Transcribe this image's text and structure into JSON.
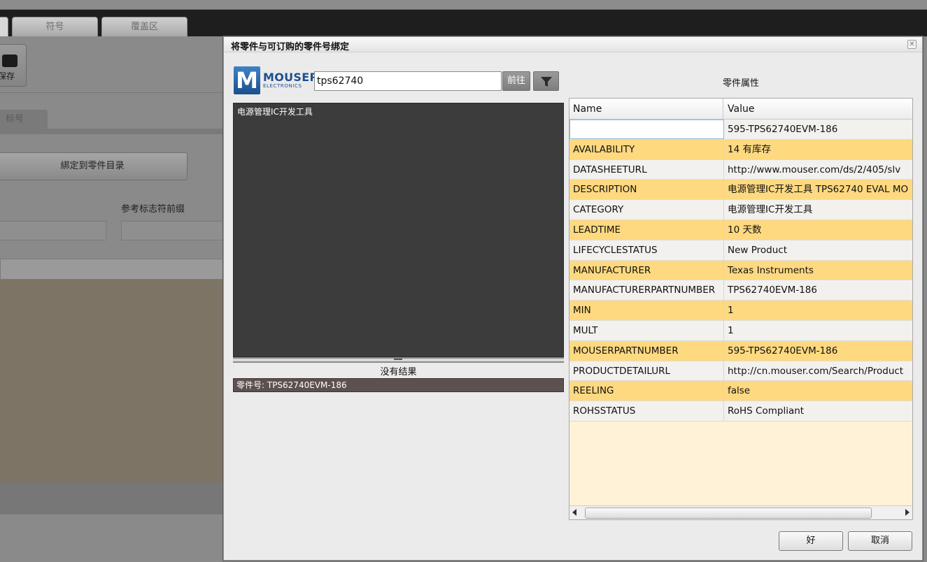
{
  "app": {
    "tabs": [
      {
        "label": ""
      },
      {
        "label": "符号"
      },
      {
        "label": "覆盖区"
      }
    ],
    "toolbar": {
      "save_label": "保存"
    },
    "sub_tab": "标号",
    "bind_catalog_button": "綁定到零件目录",
    "prefix_label": "参考标志符前缀"
  },
  "dialog": {
    "title": "将零件与可订购的零件号绑定",
    "close_icon": "close-icon",
    "logo": {
      "word": "MOUSER",
      "sub": "ELECTRONICS"
    },
    "search": {
      "value": "tps62740",
      "go_label": "前往",
      "filter_icon": "filter-icon"
    },
    "category_tree": {
      "items": [
        "电源管理IC开发工具"
      ]
    },
    "no_results": "没有结果",
    "part_result": "零件号: TPS62740EVM-186",
    "properties": {
      "title": "零件属性",
      "columns": {
        "name": "Name",
        "value": "Value"
      },
      "rows": [
        {
          "name": "",
          "value": "595-TPS62740EVM-186"
        },
        {
          "name": "AVAILABILITY",
          "value": "14 有库存"
        },
        {
          "name": "DATASHEETURL",
          "value": "http://www.mouser.com/ds/2/405/slv"
        },
        {
          "name": "DESCRIPTION",
          "value": "电源管理IC开发工具 TPS62740 EVAL MO"
        },
        {
          "name": "CATEGORY",
          "value": "电源管理IC开发工具"
        },
        {
          "name": "LEADTIME",
          "value": "10 天数"
        },
        {
          "name": "LIFECYCLESTATUS",
          "value": "New Product"
        },
        {
          "name": "MANUFACTURER",
          "value": "Texas Instruments"
        },
        {
          "name": "MANUFACTURERPARTNUMBER",
          "value": "TPS62740EVM-186"
        },
        {
          "name": "MIN",
          "value": "1"
        },
        {
          "name": "MULT",
          "value": "1"
        },
        {
          "name": "MOUSERPARTNUMBER",
          "value": "595-TPS62740EVM-186"
        },
        {
          "name": "PRODUCTDETAILURL",
          "value": "http://cn.mouser.com/Search/Product"
        },
        {
          "name": "REELING",
          "value": "false"
        },
        {
          "name": "ROHSSTATUS",
          "value": "RoHS Compliant"
        }
      ]
    },
    "buttons": {
      "ok": "好",
      "cancel": "取消"
    },
    "colors": {
      "row_highlight": "#ffd980",
      "row_plain": "#f2f1ee",
      "grid_empty": "#fff2d6",
      "results_bg": "#3c3c3c",
      "selected_part": "#5d5150"
    }
  }
}
